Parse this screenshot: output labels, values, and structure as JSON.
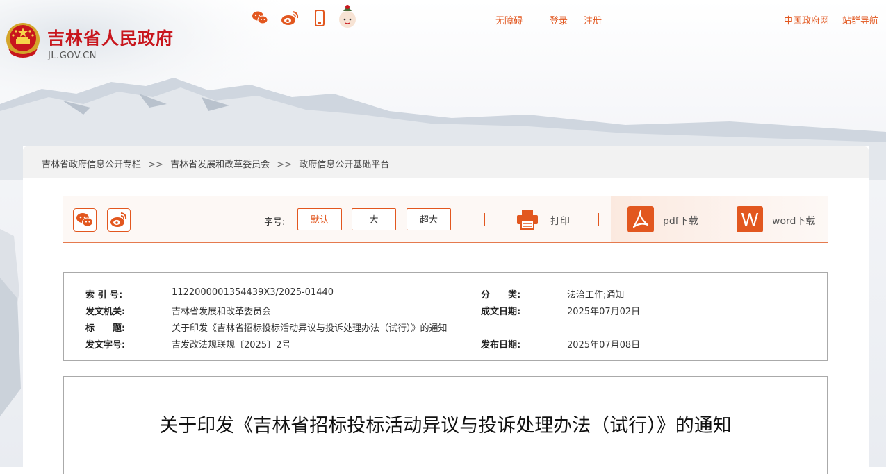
{
  "header": {
    "site_title": "吉林省人民政府",
    "site_domain": "JL.GOV.CN",
    "links": {
      "accessibility": "无障碍",
      "login": "登录",
      "register": "注册",
      "gov_portal": "中国政府网",
      "site_nav": "站群导航"
    }
  },
  "breadcrumb": {
    "items": [
      "吉林省政府信息公开专栏",
      "吉林省发展和改革委员会",
      "政府信息公开基础平台"
    ],
    "separator": ">>"
  },
  "toolbar": {
    "font_size_label": "字号:",
    "sizes": [
      "默认",
      "大",
      "超大"
    ],
    "print": "打印",
    "pdf": "pdf下载",
    "word": "word下载",
    "word_icon_letter": "W"
  },
  "info": {
    "index_label": "索 引 号:",
    "index_value": "1122000001354439X3/2025-01440",
    "category_label": "分　　类:",
    "category_value": "法治工作;通知",
    "issuer_label": "发文机关:",
    "issuer_value": "吉林省发展和改革委员会",
    "written_date_label": "成文日期:",
    "written_date_value": "2025年07月02日",
    "title_label": "标　　题:",
    "title_value": "关于印发《吉林省招标投标活动异议与投诉处理办法（试行）》的通知",
    "doc_no_label": "发文字号:",
    "doc_no_value": "吉发改法规联规〔2025〕2号",
    "publish_date_label": "发布日期:",
    "publish_date_value": "2025年07月08日"
  },
  "article": {
    "title": "关于印发《吉林省招标投标活动异议与投诉处理办法（试行）》的通知"
  },
  "colors": {
    "brand_red": "#c8161d",
    "accent_orange": "#e2571f"
  }
}
